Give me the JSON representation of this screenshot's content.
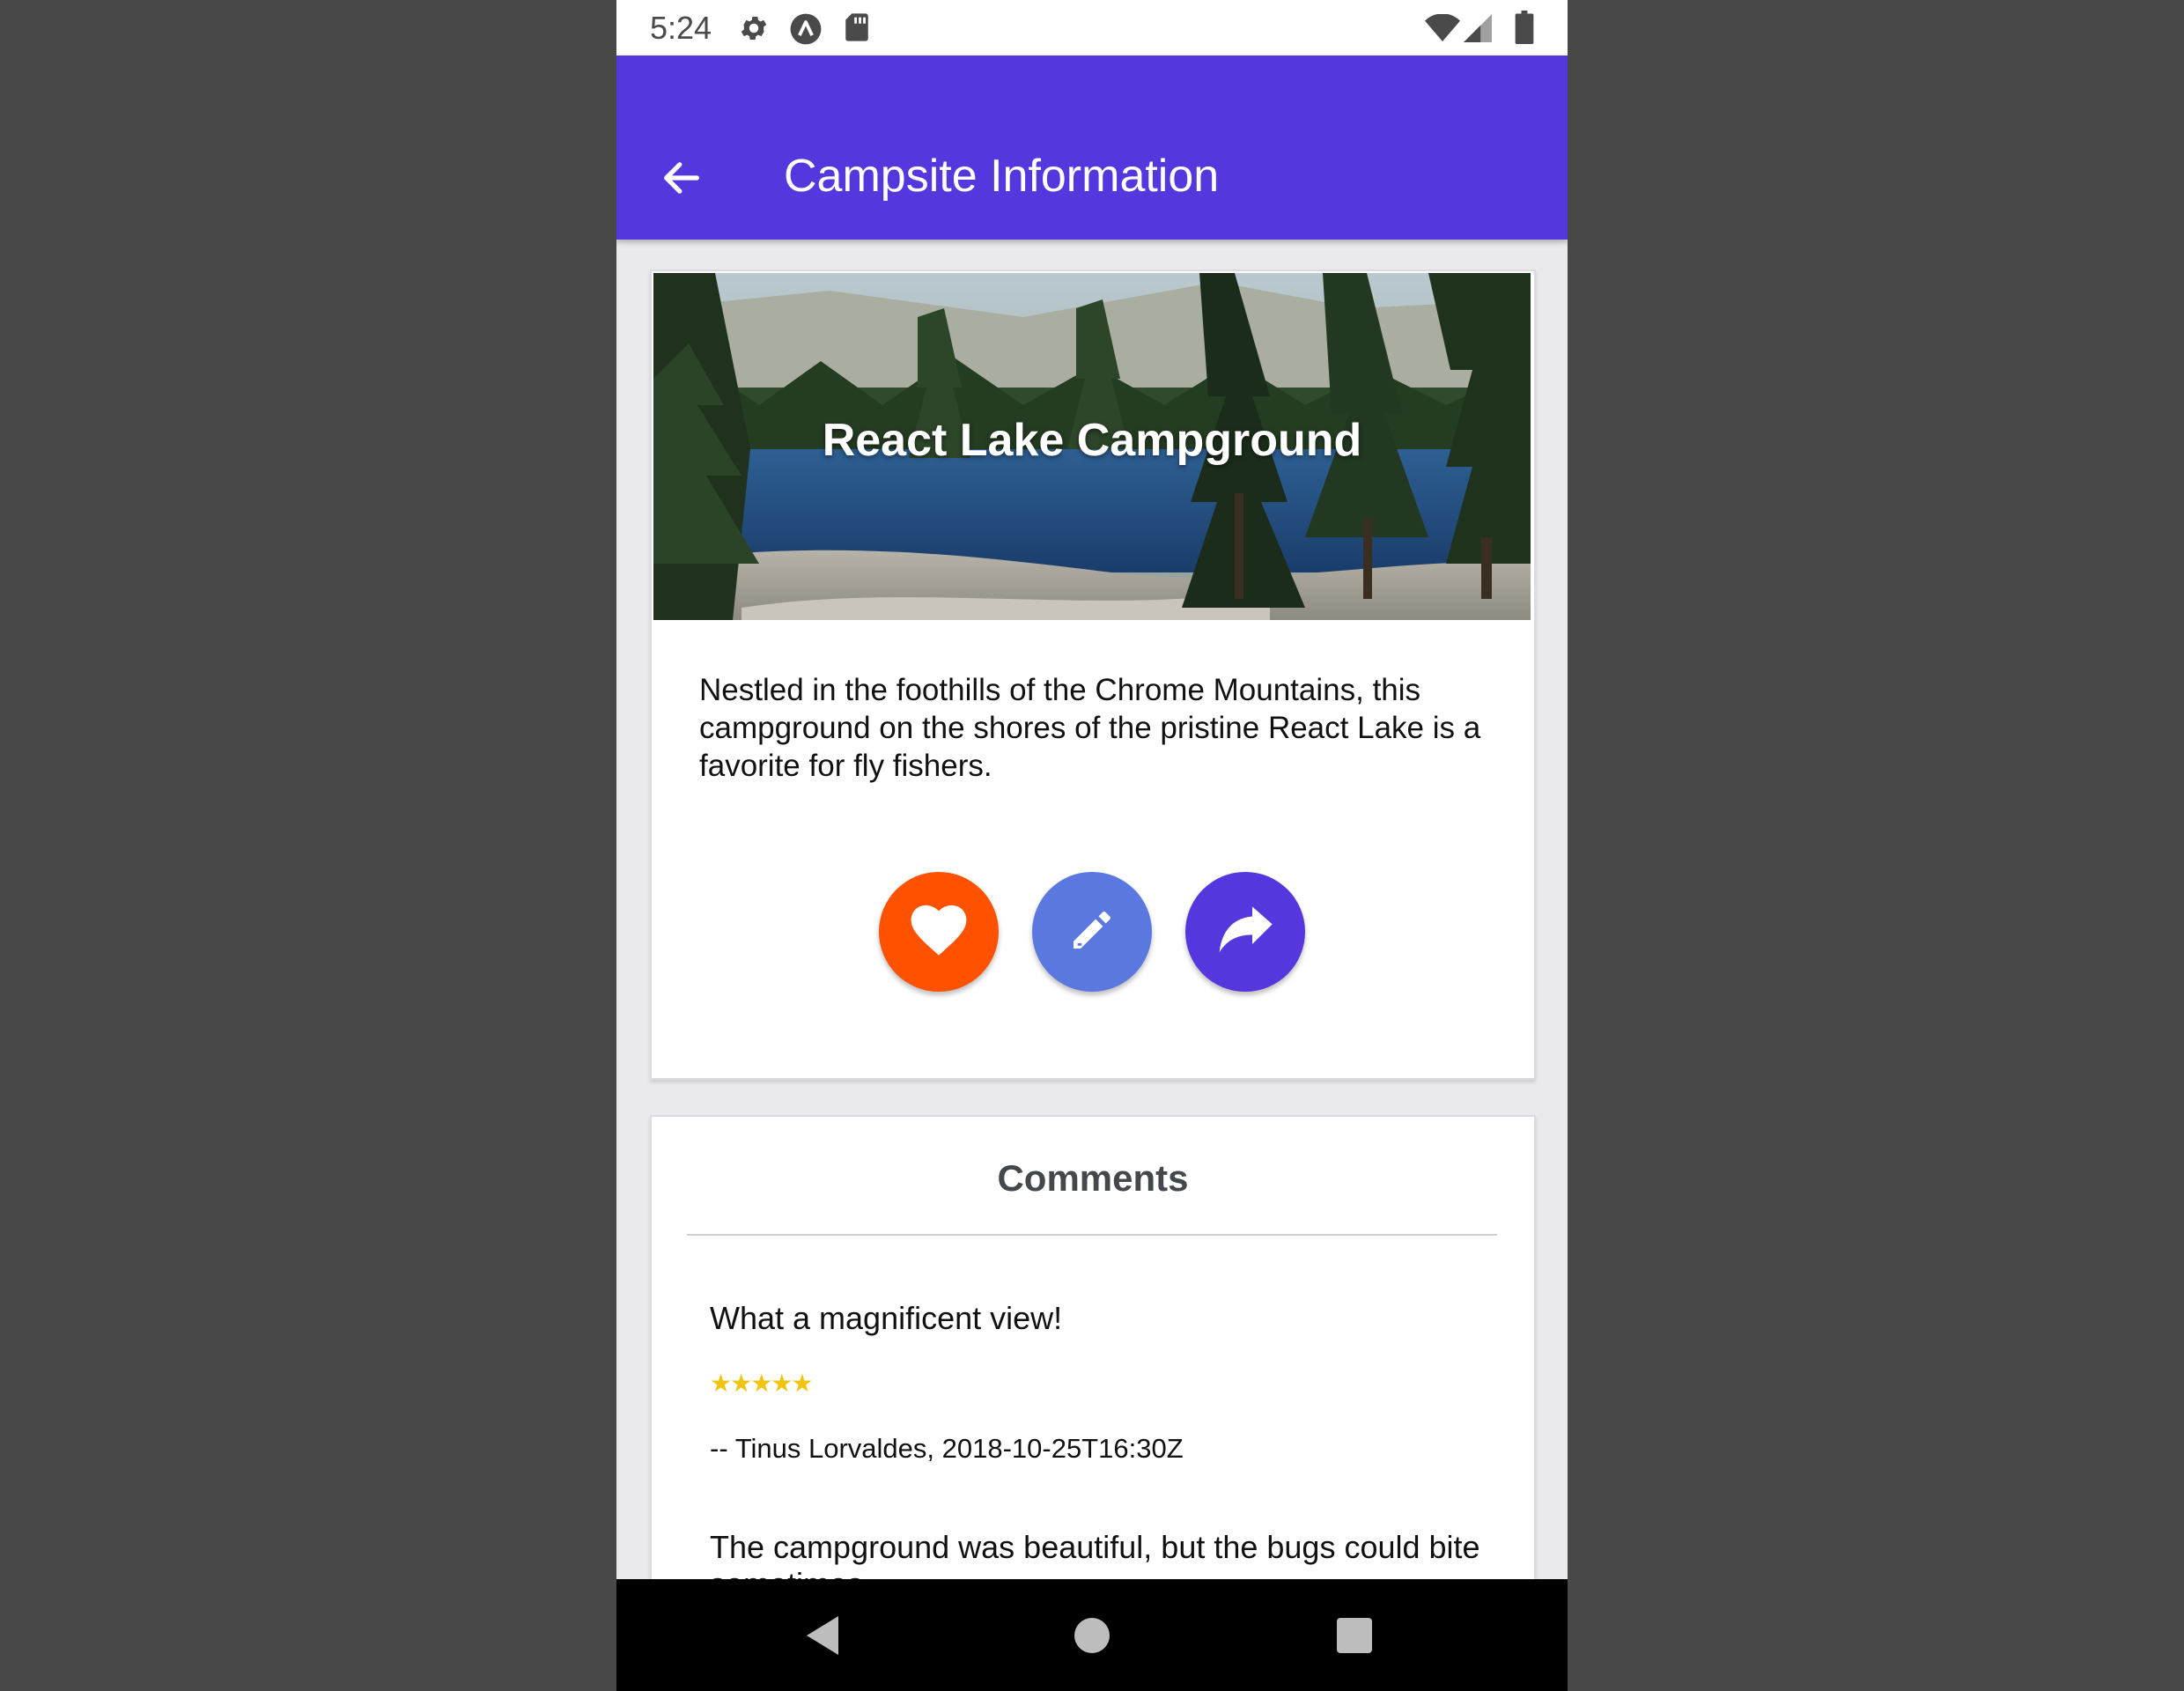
{
  "status_bar": {
    "time": "5:24",
    "icons": [
      "gear-icon",
      "expo-icon",
      "sd-card-icon",
      "wifi-icon",
      "cellular-signal-icon",
      "battery-icon"
    ]
  },
  "app_bar": {
    "back_icon": "arrow-left-icon",
    "title": "Campsite Information",
    "color": "#5637dd"
  },
  "campsite": {
    "name": "React Lake Campground",
    "description": "Nestled in the foothills of the Chrome Mountains, this campground on the shores of the pristine React Lake is a favorite for fly fishers.",
    "actions": [
      {
        "icon": "heart-icon",
        "color": "#ff5200"
      },
      {
        "icon": "pencil-icon",
        "color": "#5a78e0"
      },
      {
        "icon": "share-icon",
        "color": "#5637dd"
      }
    ]
  },
  "comments": {
    "title": "Comments",
    "items": [
      {
        "text": "What a magnificent view!",
        "rating": 5,
        "rating_stars": "★★★★★",
        "author_line": "-- Tinus Lorvaldes, 2018-10-25T16:30Z"
      },
      {
        "text": "The campground was beautiful, but the bugs could bite sometimes."
      }
    ]
  },
  "nav_bar": {
    "icons": [
      "back-triangle-icon",
      "home-circle-icon",
      "recents-square-icon"
    ]
  }
}
